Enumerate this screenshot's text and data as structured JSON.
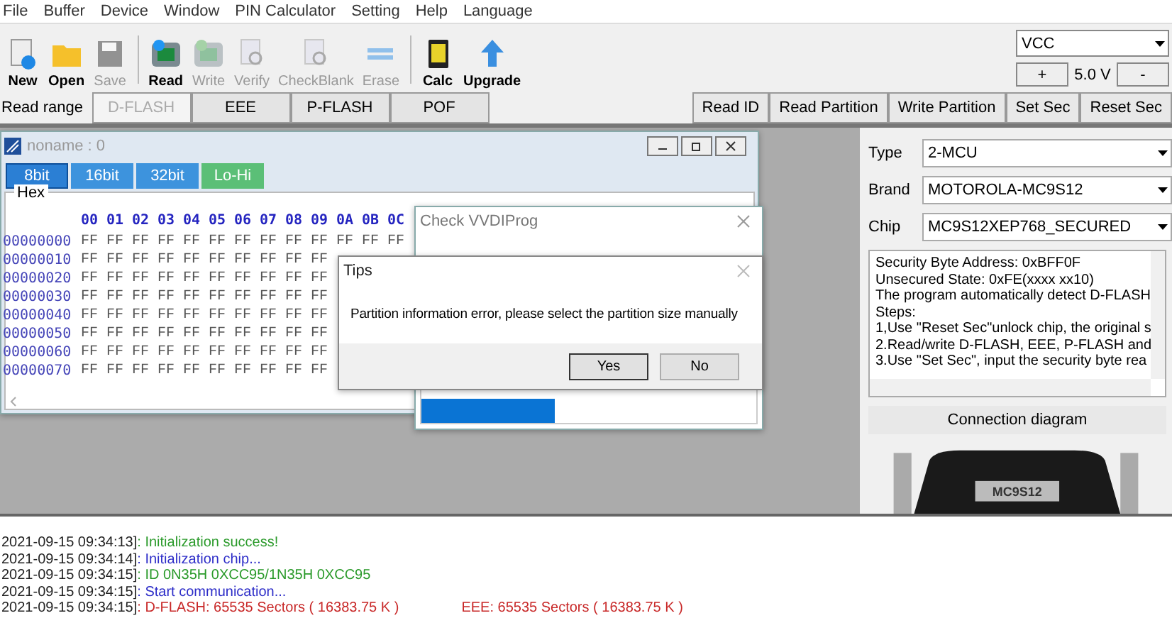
{
  "menu": [
    "File",
    "Buffer",
    "Device",
    "Window",
    "PIN Calculator",
    "Setting",
    "Help",
    "Language"
  ],
  "toolbar": [
    {
      "label": "New",
      "disabled": false
    },
    {
      "label": "Open",
      "disabled": false
    },
    {
      "label": "Save",
      "disabled": true
    },
    {
      "label": "Read",
      "disabled": false
    },
    {
      "label": "Write",
      "disabled": true
    },
    {
      "label": "Verify",
      "disabled": true
    },
    {
      "label": "CheckBlank",
      "disabled": true
    },
    {
      "label": "Erase",
      "disabled": true
    },
    {
      "label": "Calc",
      "disabled": false
    },
    {
      "label": "Upgrade",
      "disabled": false
    }
  ],
  "power": {
    "source": "VCC",
    "plus": "+",
    "voltage": "5.0 V",
    "minus": "-"
  },
  "read_range": {
    "label": "Read range",
    "tabs": [
      {
        "label": "D-FLASH",
        "selected": true
      },
      {
        "label": "EEE",
        "selected": false
      },
      {
        "label": "P-FLASH",
        "selected": false
      },
      {
        "label": "POF",
        "selected": false
      }
    ]
  },
  "actions": [
    "Read ID",
    "Read Partition",
    "Write Partition",
    "Set Sec",
    "Reset Sec"
  ],
  "hex_window": {
    "title": "noname : 0",
    "modes": [
      {
        "label": "8bit",
        "selected": true
      },
      {
        "label": "16bit",
        "selected": false
      },
      {
        "label": "32bit",
        "selected": false
      },
      {
        "label": "Lo-Hi",
        "selected": false
      }
    ],
    "group": "Hex",
    "columns": [
      "00",
      "01",
      "02",
      "03",
      "04",
      "05",
      "06",
      "07",
      "08",
      "09",
      "0A",
      "0B",
      "0C"
    ],
    "rows": [
      {
        "address": "00000000",
        "cells": [
          "FF",
          "FF",
          "FF",
          "FF",
          "FF",
          "FF",
          "FF",
          "FF",
          "FF",
          "FF",
          "FF",
          "FF",
          "FF"
        ]
      },
      {
        "address": "00000010",
        "cells": [
          "FF",
          "FF",
          "FF",
          "FF",
          "FF",
          "FF",
          "FF",
          "FF",
          "FF",
          "FF"
        ]
      },
      {
        "address": "00000020",
        "cells": [
          "FF",
          "FF",
          "FF",
          "FF",
          "FF",
          "FF",
          "FF",
          "FF",
          "FF",
          "FF"
        ]
      },
      {
        "address": "00000030",
        "cells": [
          "FF",
          "FF",
          "FF",
          "FF",
          "FF",
          "FF",
          "FF",
          "FF",
          "FF",
          "FF"
        ]
      },
      {
        "address": "00000040",
        "cells": [
          "FF",
          "FF",
          "FF",
          "FF",
          "FF",
          "FF",
          "FF",
          "FF",
          "FF",
          "FF"
        ]
      },
      {
        "address": "00000050",
        "cells": [
          "FF",
          "FF",
          "FF",
          "FF",
          "FF",
          "FF",
          "FF",
          "FF",
          "FF",
          "FF"
        ]
      },
      {
        "address": "00000060",
        "cells": [
          "FF",
          "FF",
          "FF",
          "FF",
          "FF",
          "FF",
          "FF",
          "FF",
          "FF",
          "FF"
        ]
      },
      {
        "address": "00000070",
        "cells": [
          "FF",
          "FF",
          "FF",
          "FF",
          "FF",
          "FF",
          "FF",
          "FF",
          "FF",
          "FF"
        ]
      }
    ]
  },
  "check_dialog": {
    "title": "Check VVDIProg",
    "level": 0.4
  },
  "tips_dialog": {
    "title": "Tips",
    "message": "Partition information error, please select the partition size manually",
    "buttons": [
      {
        "label": "Yes",
        "selected": true
      },
      {
        "label": "No",
        "selected": false
      }
    ]
  },
  "chip_panel": {
    "fields": [
      {
        "label": "Type",
        "value": "2-MCU"
      },
      {
        "label": "Brand",
        "value": "MOTOROLA-MC9S12"
      },
      {
        "label": "Chip",
        "value": "MC9S12XEP768_SECURED"
      }
    ],
    "info": [
      "Security Byte Address: 0xBFF0F",
      "Unsecured State: 0xFE(xxxx xx10)",
      "The program automatically detect D-FLASH",
      "Steps:",
      "1,Use \"Reset Sec\"unlock chip, the original s",
      "2.Read/write D-FLASH, EEE, P-FLASH and",
      "3.Use \"Set Sec\", input the security byte rea"
    ],
    "diagram_button": "Connection diagram",
    "cable_label": "MC9S12"
  },
  "log": [
    {
      "time": "2021-09-15 09:34:13]",
      "parts": [
        {
          "text": ": Initialization success!",
          "kind": "ok"
        }
      ]
    },
    {
      "time": "2021-09-15 09:34:14]",
      "parts": [
        {
          "text": ": Initialization chip...",
          "kind": "info"
        }
      ]
    },
    {
      "time": "2021-09-15 09:34:15]",
      "parts": [
        {
          "text": ": ID  0N35H 0XCC95/1N35H 0XCC95",
          "kind": "ok"
        }
      ]
    },
    {
      "time": "2021-09-15 09:34:15]",
      "parts": [
        {
          "text": ": Start communication...",
          "kind": "info"
        }
      ]
    },
    {
      "time": "2021-09-15 09:34:15]",
      "parts": [
        {
          "text": ": D-FLASH: 65535 Sectors ( 16383.75 K )",
          "kind": "error"
        },
        {
          "text": "EEE: 65535 Sectors ( 16383.75 K )",
          "kind": "error"
        }
      ]
    }
  ]
}
